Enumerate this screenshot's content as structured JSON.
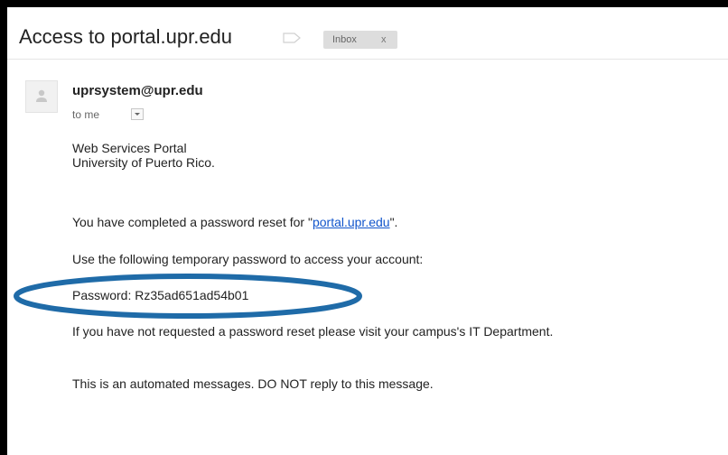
{
  "email": {
    "subject": "Access to portal.upr.edu",
    "label_chip": "Inbox",
    "label_chip_close": "x",
    "sender": "uprsystem@upr.edu",
    "recipient": "to me",
    "body": {
      "org_line1": "Web Services Portal",
      "org_line2": "University of Puerto Rico.",
      "reset_prefix": "You have completed a password reset for \"",
      "reset_link": "portal.upr.edu",
      "reset_suffix": "\".",
      "instructions": "Use the following temporary password to access your account:",
      "password_line": "Password: Rz35ad651ad54b01",
      "not_requested": "If you have not requested a password reset please visit your campus's IT Department.",
      "automated_note": "This is an automated messages. DO NOT reply to this message."
    }
  },
  "colors": {
    "highlight_ellipse": "#1f6ba8",
    "link": "#1155cc",
    "frame_border": "#000000"
  },
  "icons": {
    "label": "label-outline-icon",
    "avatar": "person-icon",
    "dropdown": "chevron-down-icon"
  }
}
